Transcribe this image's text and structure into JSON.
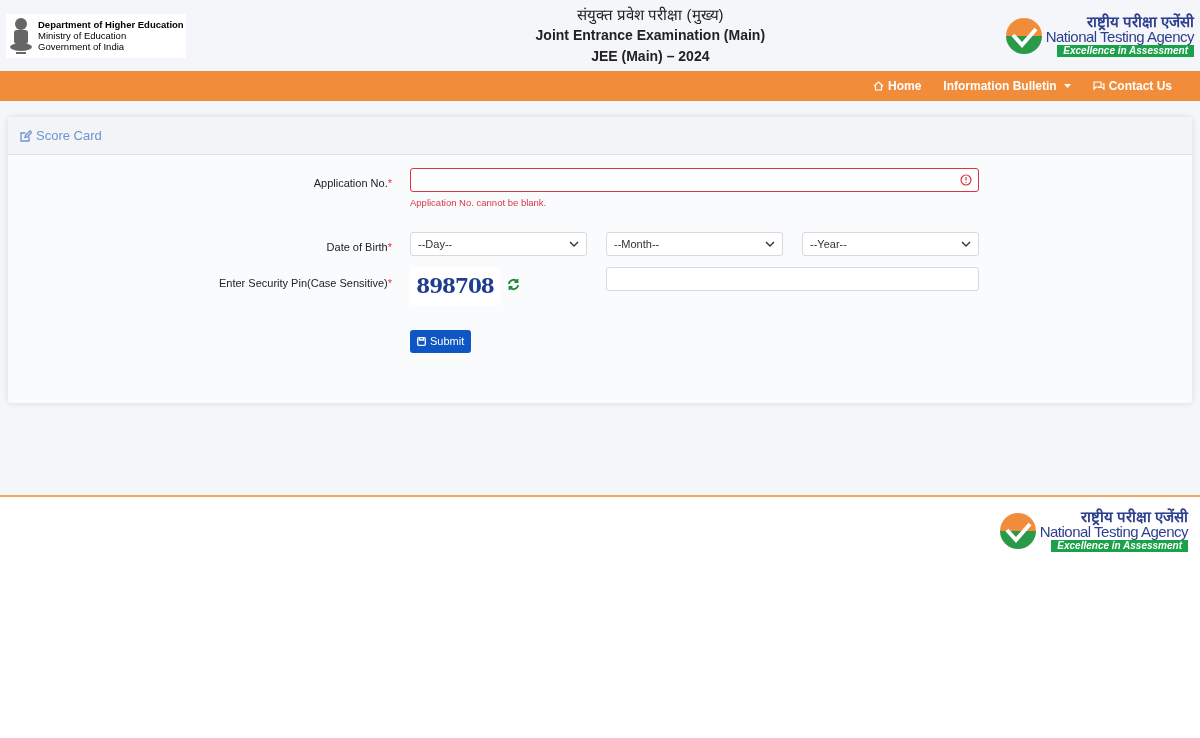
{
  "header": {
    "ministry": [
      "Department of Higher Education",
      "Ministry of Education",
      "Government of India"
    ],
    "title_lines": [
      "संयुक्त प्रवेश परीक्षा (मुख्य)",
      "Joint Entrance Examination (Main)",
      "JEE (Main) – 2024"
    ],
    "agency_logo": {
      "hindi": "राष्ट्रीय परीक्षा एजेंसी",
      "english": "National Testing Agency",
      "tagline": "Excellence in Assessment"
    }
  },
  "nav": [
    {
      "label": "Home",
      "kind": "home"
    },
    {
      "label": "Information Bulletin",
      "kind": "dropdown"
    },
    {
      "label": "Contact Us",
      "kind": "contact"
    }
  ],
  "card": {
    "title": "Score Card"
  },
  "form": {
    "application": {
      "label": "Application No.",
      "mark": "*",
      "invalid": true,
      "error": "Application No. cannot be blank."
    },
    "dob": {
      "label": "Date of Birth",
      "mark": "*",
      "selects": [
        {
          "placeholder": "--Day--"
        },
        {
          "placeholder": "--Month--"
        },
        {
          "placeholder": "--Year--"
        }
      ]
    },
    "security": {
      "label": "Enter Security Pin(Case Sensitive)",
      "mark": "*",
      "captcha": "898708"
    },
    "submit": "Submit"
  },
  "footer": {
    "agency_logo": {
      "hindi": "राष्ट्रीय परीक्षा एजेंसी",
      "english": "National Testing Agency",
      "tagline": "Excellence in Assessment"
    }
  }
}
